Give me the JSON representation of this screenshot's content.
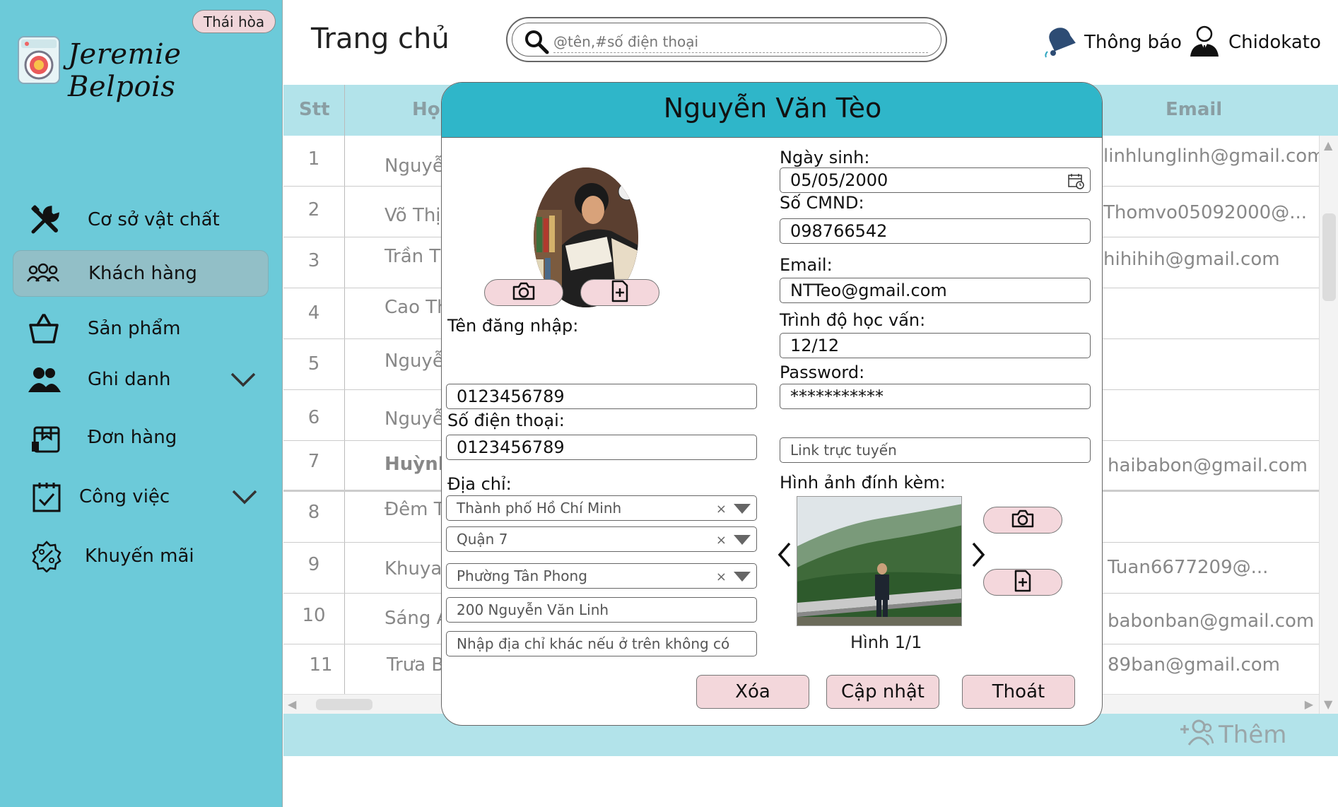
{
  "sidebar": {
    "branch": "Thái hòa",
    "brand": "Jeremie Belpois",
    "items": [
      {
        "label": "Cơ sở vật chất"
      },
      {
        "label": "Khách hàng"
      },
      {
        "label": "Sản phẩm"
      },
      {
        "label": "Ghi danh"
      },
      {
        "label": "Đơn hàng"
      },
      {
        "label": "Công việc"
      },
      {
        "label": "Khuyến mãi"
      }
    ]
  },
  "header": {
    "title": "Trang chủ",
    "search_placeholder": "@tên,#số điện thoại",
    "notifications_label": "Thông báo",
    "user_name": "Chidokato"
  },
  "table": {
    "columns": {
      "stt": "Stt",
      "name": "Họ",
      "email": "Email"
    },
    "rows": [
      {
        "stt": "1",
        "name": "Nguyễn",
        "email": "linhlunglinh@gmail.com"
      },
      {
        "stt": "2",
        "name": "Võ Thị",
        "email": "Thomvo05092000@..."
      },
      {
        "stt": "3",
        "name": "Trần Th",
        "email": "hihihih@gmail.com"
      },
      {
        "stt": "4",
        "name": "Cao Th",
        "email": ""
      },
      {
        "stt": "5",
        "name": "Nguyễn",
        "email": ""
      },
      {
        "stt": "6",
        "name": "Nguyễn",
        "email": ""
      },
      {
        "stt": "7",
        "name": "Huỳnh",
        "email": "haibabon@gmail.com"
      },
      {
        "stt": "8",
        "name": "Đêm T",
        "email": ""
      },
      {
        "stt": "9",
        "name": "Khuya",
        "email": "Tuan6677209@..."
      },
      {
        "stt": "10",
        "name": "Sáng A",
        "email": "babonban@gmail.com"
      },
      {
        "stt": "11",
        "name": "Trưa B",
        "email": "89ban@gmail.com"
      }
    ],
    "add_label": "Thêm"
  },
  "modal": {
    "title": "Nguyễn Văn Tèo",
    "username_label": "Tên đăng nhập:",
    "username": "0123456789",
    "phone_label": "Số điện thoại:",
    "phone": "0123456789",
    "address_label": "Địa chỉ:",
    "city": "Thành phố Hồ Chí Minh",
    "district": "Quận 7",
    "ward": "Phường Tân Phong",
    "street": "200 Nguyễn Văn Linh",
    "other_address_placeholder": "Nhập địa chỉ khác nếu ở trên không có",
    "dob_label": "Ngày sinh:",
    "dob": "05/05/2000",
    "id_label": "Số CMND:",
    "id_number": "098766542",
    "email_label": "Email:",
    "email": "NTTeo@gmail.com",
    "education_label": "Trình độ học vấn:",
    "education": "12/12",
    "password_label": "Password:",
    "password": "***********",
    "link_placeholder": "Link trực tuyến",
    "attach_label": "Hình ảnh đính kèm:",
    "image_counter": "Hình 1/1",
    "delete_label": "Xóa",
    "update_label": "Cập nhật",
    "exit_label": "Thoát",
    "select_clear": "×"
  }
}
